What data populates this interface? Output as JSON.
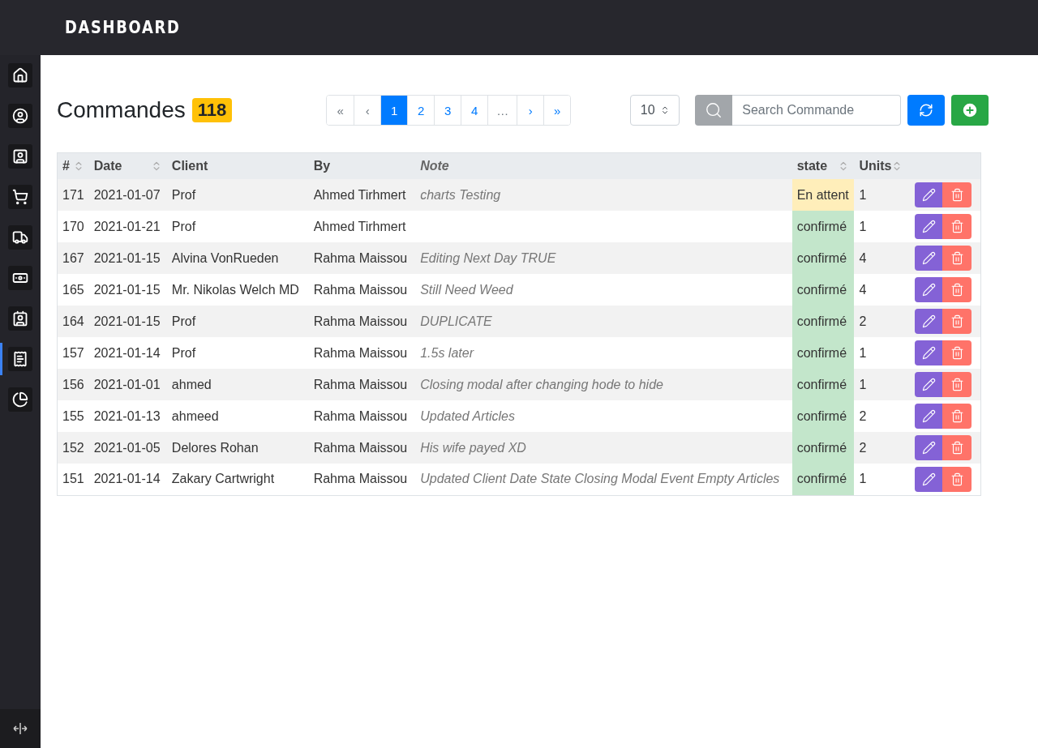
{
  "app": {
    "title": "DASHBOARD"
  },
  "sidebar": {
    "items": [
      {
        "selected": false
      },
      {
        "selected": false
      },
      {
        "selected": false
      },
      {
        "selected": false
      },
      {
        "selected": false
      },
      {
        "selected": false
      },
      {
        "selected": false
      },
      {
        "selected": true
      },
      {
        "selected": false
      }
    ]
  },
  "page": {
    "title": "Commandes",
    "count": "118"
  },
  "pagination": [
    {
      "label": "«",
      "selected": false,
      "disabled": true
    },
    {
      "label": "‹",
      "selected": false,
      "disabled": true
    },
    {
      "label": "1",
      "selected": true,
      "disabled": false
    },
    {
      "label": "2",
      "selected": false,
      "disabled": false
    },
    {
      "label": "3",
      "selected": false,
      "disabled": false
    },
    {
      "label": "4",
      "selected": false,
      "disabled": false
    },
    {
      "label": "…",
      "selected": false,
      "disabled": true
    },
    {
      "label": "›",
      "selected": false,
      "disabled": false
    },
    {
      "label": "»",
      "selected": false,
      "disabled": false
    }
  ],
  "page_size": "10",
  "search": {
    "placeholder": "Search Commande"
  },
  "table": {
    "columns": [
      {
        "label": "#",
        "sortable": true
      },
      {
        "label": "Date",
        "sortable": true
      },
      {
        "label": "Client",
        "sortable": false
      },
      {
        "label": "By",
        "sortable": false
      },
      {
        "label": "Note",
        "sortable": false
      },
      {
        "label": "state",
        "sortable": true
      },
      {
        "label": "Units",
        "sortable": true
      }
    ],
    "rows": [
      {
        "id": "171",
        "date": "2021-01-07",
        "client": "Prof",
        "by": "Ahmed Tirhmert",
        "note": "charts Testing",
        "state": "En attent",
        "confirmed": false,
        "units": "1"
      },
      {
        "id": "170",
        "date": "2021-01-21",
        "client": "Prof",
        "by": "Ahmed Tirhmert",
        "note": "",
        "state": "confirmé",
        "confirmed": true,
        "units": "1"
      },
      {
        "id": "167",
        "date": "2021-01-15",
        "client": "Alvina VonRueden",
        "by": "Rahma Maissou",
        "note": "Editing Next Day TRUE",
        "state": "confirmé",
        "confirmed": true,
        "units": "4"
      },
      {
        "id": "165",
        "date": "2021-01-15",
        "client": "Mr. Nikolas Welch MD",
        "by": "Rahma Maissou",
        "note": "Still Need Weed",
        "state": "confirmé",
        "confirmed": true,
        "units": "4"
      },
      {
        "id": "164",
        "date": "2021-01-15",
        "client": "Prof",
        "by": "Rahma Maissou",
        "note": "DUPLICATE",
        "state": "confirmé",
        "confirmed": true,
        "units": "2"
      },
      {
        "id": "157",
        "date": "2021-01-14",
        "client": "Prof",
        "by": "Rahma Maissou",
        "note": "1.5s later",
        "state": "confirmé",
        "confirmed": true,
        "units": "1"
      },
      {
        "id": "156",
        "date": "2021-01-01",
        "client": "ahmed",
        "by": "Rahma Maissou",
        "note": "Closing modal after changing hode to hide",
        "state": "confirmé",
        "confirmed": true,
        "units": "1"
      },
      {
        "id": "155",
        "date": "2021-01-13",
        "client": "ahmeed",
        "by": "Rahma Maissou",
        "note": "Updated Articles",
        "state": "confirmé",
        "confirmed": true,
        "units": "2"
      },
      {
        "id": "152",
        "date": "2021-01-05",
        "client": "Delores Rohan",
        "by": "Rahma Maissou",
        "note": "His wife payed XD",
        "state": "confirmé",
        "confirmed": true,
        "units": "2"
      },
      {
        "id": "151",
        "date": "2021-01-14",
        "client": "Zakary Cartwright",
        "by": "Rahma Maissou",
        "note": "Updated Client Date State Closing Modal Event Empty Articles",
        "state": "confirmé",
        "confirmed": true,
        "units": "1"
      }
    ]
  }
}
